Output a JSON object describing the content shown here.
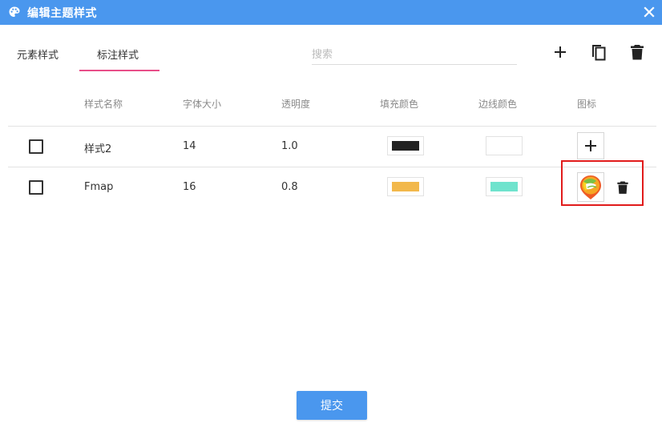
{
  "dialog": {
    "title": "编辑主题样式",
    "header_color": "#4a97ee"
  },
  "tabs": [
    {
      "label": "元素样式",
      "active": false
    },
    {
      "label": "标注样式",
      "active": true
    }
  ],
  "search": {
    "placeholder": "搜索",
    "value": ""
  },
  "toolbar": {
    "add_icon": "plus-icon",
    "copy_icon": "copy-icon",
    "delete_icon": "trash-icon"
  },
  "table": {
    "columns": [
      "样式名称",
      "字体大小",
      "透明度",
      "填充颜色",
      "边线颜色",
      "图标"
    ],
    "rows": [
      {
        "name": "样式2",
        "font_size": "14",
        "opacity": "1.0",
        "fill_color": "#222222",
        "stroke_color": "#ffffff",
        "icon": "plus-icon"
      },
      {
        "name": "Fmap",
        "font_size": "16",
        "opacity": "0.8",
        "fill_color": "#f2b84b",
        "stroke_color": "#6fe3cd",
        "icon": "fmap-logo-icon"
      }
    ]
  },
  "footer": {
    "submit_label": "提交"
  }
}
